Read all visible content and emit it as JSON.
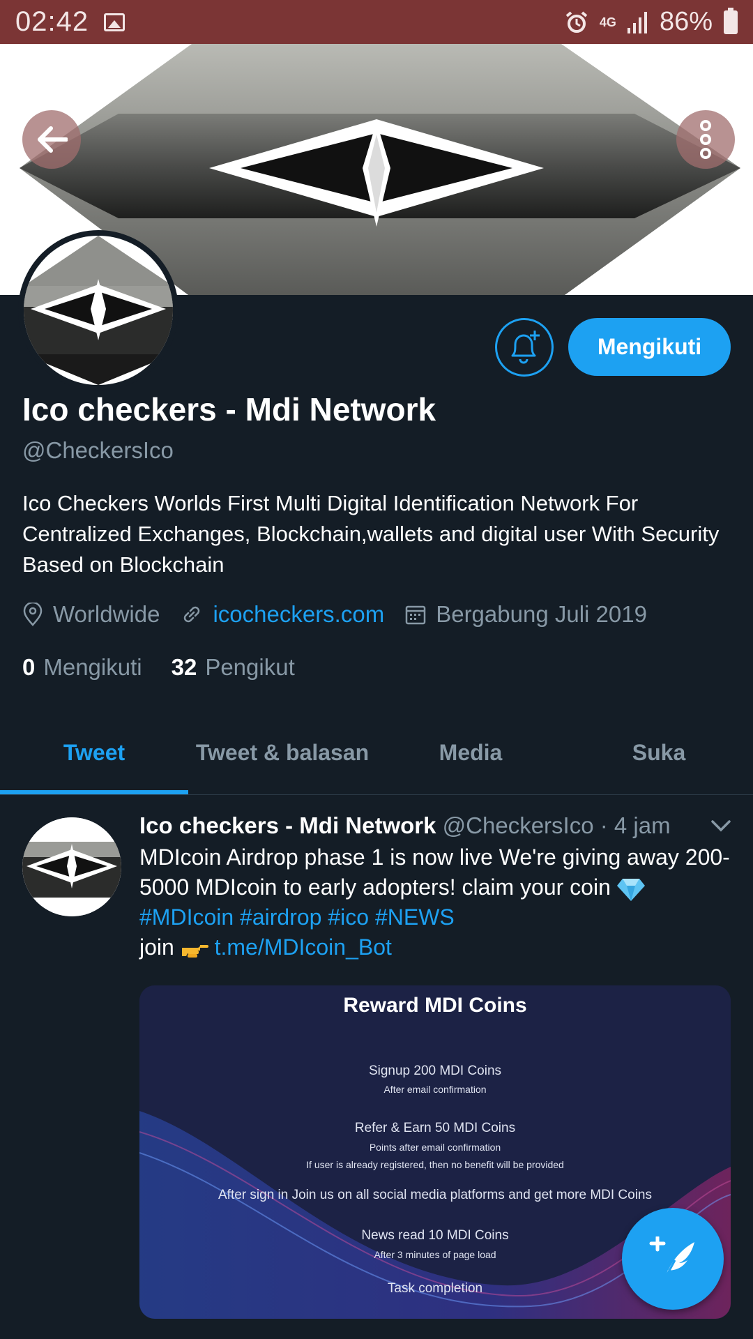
{
  "status_bar": {
    "time": "02:42",
    "network": "4G",
    "battery": "86%"
  },
  "profile": {
    "name": "Ico checkers - Mdi Network",
    "handle": "@CheckersIco",
    "bio": "Ico Checkers Worlds First Multi Digital Identification Network For Centralized Exchanges, Blockchain,wallets and digital user  With Security Based on Blockchain",
    "location": "Worldwide",
    "website": "icocheckers.com",
    "joined": "Bergabung Juli 2019",
    "following_count": "0",
    "following_label": "Mengikuti",
    "followers_count": "32",
    "followers_label": "Pengikut",
    "follow_button": "Mengikuti"
  },
  "tabs": [
    {
      "label": "Tweet",
      "active": true
    },
    {
      "label": "Tweet & balasan",
      "active": false
    },
    {
      "label": "Media",
      "active": false
    },
    {
      "label": "Suka",
      "active": false
    }
  ],
  "tweet": {
    "author": "Ico checkers - Mdi Network",
    "handle": "@CheckersIco",
    "time": "· 4 jam",
    "text_line1": "MDIcoin Airdrop phase 1 is now live We're giving away 200-5000 MDIcoin to early adopters! claim your coin",
    "hashtags": "#MDIcoin #airdrop #ico #NEWS",
    "join_text": "join",
    "link": "t.me/MDIcoin_Bot",
    "card": {
      "title": "Reward MDI Coins",
      "signup": "Signup 200 MDI Coins",
      "signup_note": "After email confirmation",
      "refer": "Refer & Earn 50 MDI Coins",
      "refer_note1": "Points after email confirmation",
      "refer_note2": "If user is already registered, then no benefit will be provided",
      "social": "After sign in Join us on all social media platforms and get more MDI Coins",
      "news": "News read 10 MDI Coins",
      "news_note": "After 3 minutes of page load",
      "task": "Task completion"
    }
  },
  "colors": {
    "accent": "#1da1f2",
    "background": "#141d26",
    "status_bar": "#7b3535",
    "muted": "#8899a6"
  }
}
